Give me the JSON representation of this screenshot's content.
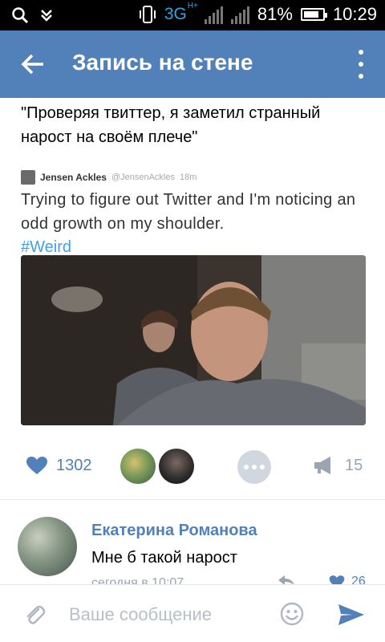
{
  "status_bar": {
    "network": "3G",
    "network_plus": "H+",
    "battery": "81%",
    "battery_level": 0.81,
    "time": "10:29"
  },
  "header": {
    "title": "Запись на стене"
  },
  "post": {
    "text": "\"Проверяя твиттер, я заметил странный нарост на своём плече\"",
    "tweet": {
      "name": "Jensen Ackles",
      "handle": "@JensenAckles",
      "time": "18m",
      "text": "Trying to figure out Twitter and I'm noticing an odd growth on my shoulder.",
      "hashtag": "#Weird"
    }
  },
  "actions": {
    "likes": "1302",
    "shares": "15"
  },
  "comment": {
    "author": "Екатерина Романова",
    "text": "Мне б такой нарост",
    "time": "сегодня в 10:07",
    "likes": "26"
  },
  "composer": {
    "placeholder": "Ваше сообщение"
  },
  "colors": {
    "accent": "#5181b8",
    "header_bg": "#5181b8",
    "muted": "#9aa5b1",
    "hashtag": "#3ea1ec"
  }
}
